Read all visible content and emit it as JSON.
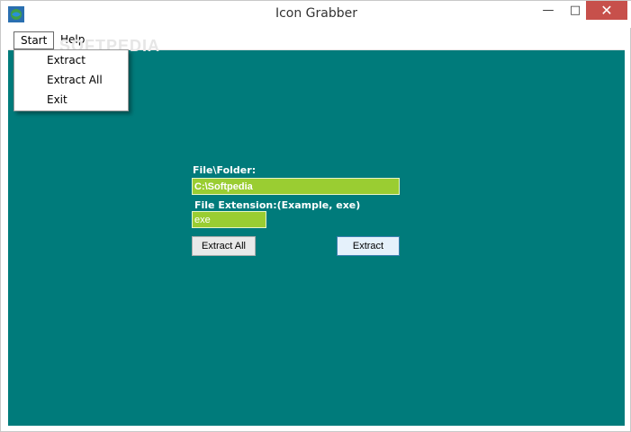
{
  "window": {
    "title": "Icon Grabber",
    "app_icon": "globe-icon"
  },
  "controls": {
    "minimize": "—",
    "maximize": "□",
    "close": "✕"
  },
  "menu": {
    "items": [
      {
        "label": "Start"
      },
      {
        "label": "Help"
      }
    ],
    "open_menu": "Start",
    "dropdown": [
      {
        "label": "Extract"
      },
      {
        "label": "Extract All"
      },
      {
        "label": "Exit"
      }
    ]
  },
  "watermark": "SOFTPEDIA",
  "form": {
    "file_label": "File\\Folder:",
    "file_value": "C:\\Softpedia",
    "ext_label": "File Extension:(Example, exe)",
    "ext_value": "exe",
    "extract_all_button": "Extract All",
    "extract_button": "Extract"
  },
  "colors": {
    "background": "#007b7b",
    "field": "#9acd32",
    "close": "#c7504b"
  }
}
